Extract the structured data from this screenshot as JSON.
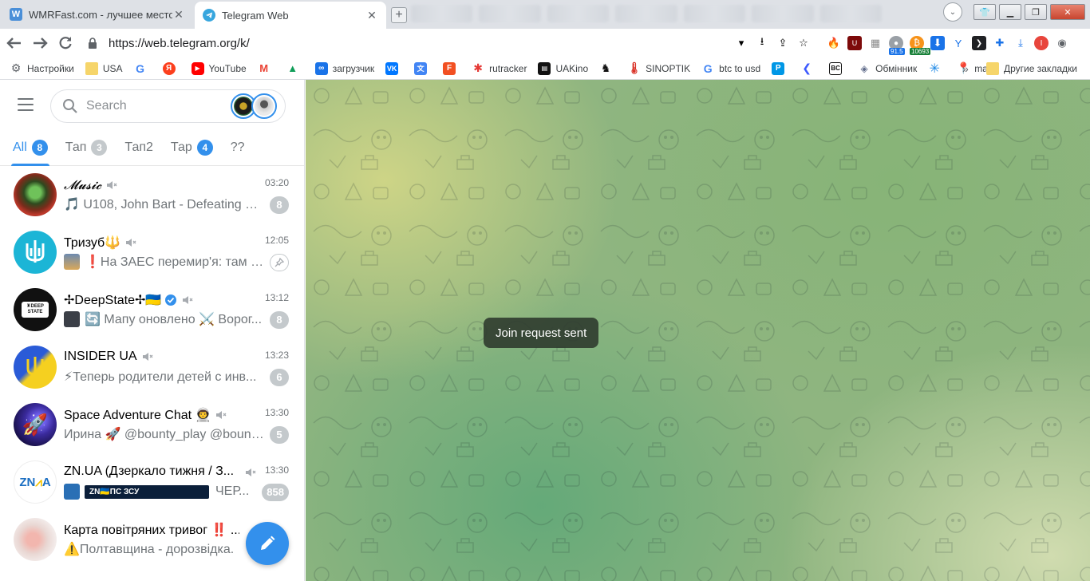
{
  "browser": {
    "tabs": [
      {
        "title": "WMRFast.com - лучшее место для",
        "favicon_letter": "W",
        "active": false
      },
      {
        "title": "Telegram Web",
        "active": true
      }
    ],
    "url": "https://web.telegram.org/k/",
    "extension_badges": [
      "91.5",
      "10693"
    ],
    "bookmarks": [
      {
        "label": "Настройки",
        "icon": "gear-icon"
      },
      {
        "label": "USA",
        "icon": "folder-icon"
      },
      {
        "label": "",
        "icon": "google-icon"
      },
      {
        "label": "",
        "icon": "yandex-icon"
      },
      {
        "label": "YouTube",
        "icon": "youtube-icon"
      },
      {
        "label": "",
        "icon": "gmail-icon"
      },
      {
        "label": "",
        "icon": "drive-icon"
      },
      {
        "label": "загрузчик",
        "icon": "loop-icon"
      },
      {
        "label": "",
        "icon": "vk-icon"
      },
      {
        "label": "",
        "icon": "translate-icon"
      },
      {
        "label": "",
        "icon": "f-icon"
      },
      {
        "label": "rutracker",
        "icon": "rutracker-icon"
      },
      {
        "label": "UAKino",
        "icon": "uakino-icon"
      },
      {
        "label": "",
        "icon": "knight-icon"
      },
      {
        "label": "SINOPTIK",
        "icon": "thermometer-icon"
      },
      {
        "label": "btc to usd",
        "icon": "google-icon"
      },
      {
        "label": "",
        "icon": "p-icon"
      },
      {
        "label": "",
        "icon": "arrow-icon"
      },
      {
        "label": "",
        "icon": "bc-icon"
      },
      {
        "label": "Обмінник",
        "icon": "exchange-icon"
      },
      {
        "label": "",
        "icon": "asterisk-icon"
      },
      {
        "label": "maps",
        "icon": "maps-icon"
      }
    ],
    "bookmarks_more": "»",
    "other_bookmarks": "Другие закладки"
  },
  "telegram": {
    "search_placeholder": "Search",
    "folders": [
      {
        "label": "All",
        "badge": "8",
        "active": true
      },
      {
        "label": "Тап",
        "badge": "3",
        "active": false
      },
      {
        "label": "Тап2",
        "badge": "",
        "active": false
      },
      {
        "label": "Тар",
        "badge": "4",
        "active": false,
        "blue": true
      },
      {
        "label": "??",
        "badge": "",
        "active": false
      }
    ],
    "chats": [
      {
        "title": "𝓜𝓾𝓼𝓲𝓬",
        "time": "03:20",
        "message": "🎵 U108, John Bart - Defeating De...",
        "badge": "8",
        "muted": true
      },
      {
        "title": "Тризуб🔱",
        "time": "12:05",
        "message": "❗На ЗАЕС перемир'я: там п...",
        "badge": "",
        "pinned": true,
        "muted": true
      },
      {
        "title": "✢DeepState✢🇺🇦",
        "time": "13:12",
        "message": "🔄 Мапу оновлено ⚔️ Ворог...",
        "badge": "8",
        "muted": true,
        "verified": true
      },
      {
        "title": "INSIDER UA",
        "time": "13:23",
        "message": "⚡Теперь родители детей с инв...",
        "badge": "6",
        "muted": true
      },
      {
        "title": "Space Adventure Chat 👨‍🚀",
        "time": "13:30",
        "message": "Ирина 🚀 @bounty_play @bounty...",
        "badge": "5",
        "muted": true
      },
      {
        "title": "ZN.UA (Дзеркало тижня / З...",
        "time": "13:30",
        "message": "ЧЕР...",
        "badge": "858",
        "muted": true,
        "banner": "ZN🇺🇦ПС ЗСУ"
      },
      {
        "title": "Карта повітряних тривог ‼️ ...",
        "time": "",
        "message": "⚠️Полтавщина - дорозвідка.",
        "badge": "",
        "muted": false
      }
    ]
  },
  "toast": "Join request sent",
  "colors": {
    "accent": "#3390ec",
    "badge_muted": "#c4c9cc"
  }
}
